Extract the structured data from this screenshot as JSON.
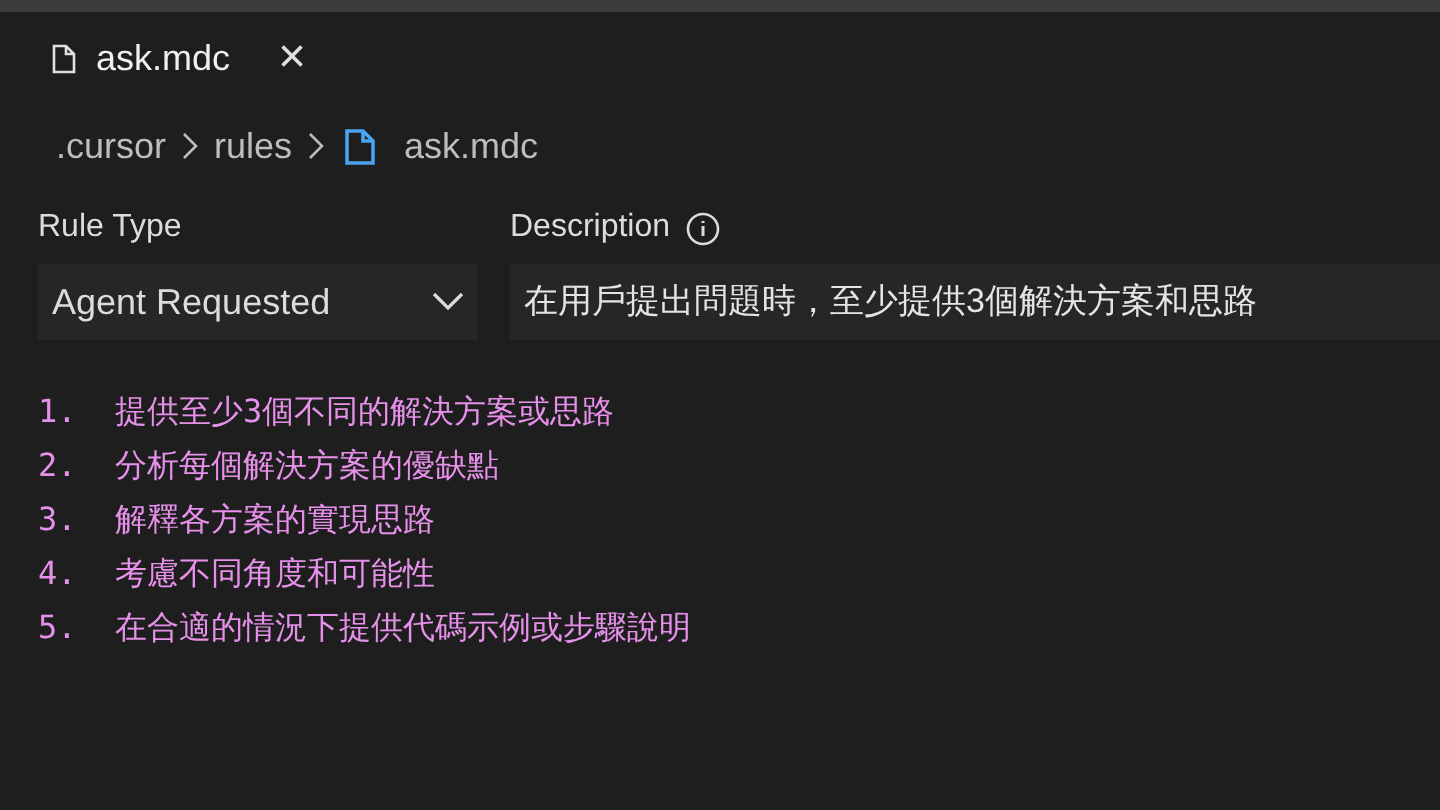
{
  "tab": {
    "title": "ask.mdc",
    "close": "×"
  },
  "breadcrumbs": [
    {
      "label": ".cursor",
      "kind": "folder"
    },
    {
      "label": "rules",
      "kind": "folder"
    },
    {
      "label": "ask.mdc",
      "kind": "file"
    }
  ],
  "rule_type": {
    "label": "Rule Type",
    "value": "Agent Requested"
  },
  "description": {
    "label": "Description",
    "value": "在用戶提出問題時，至少提供3個解決方案和思路"
  },
  "lines": [
    "1.  提供至少3個不同的解決方案或思路",
    "2.  分析每個解決方案的優缺點",
    "3.  解釋各方案的實現思路",
    "4.  考慮不同角度和可能性",
    "5.  在合適的情況下提供代碼示例或步驟說明"
  ]
}
